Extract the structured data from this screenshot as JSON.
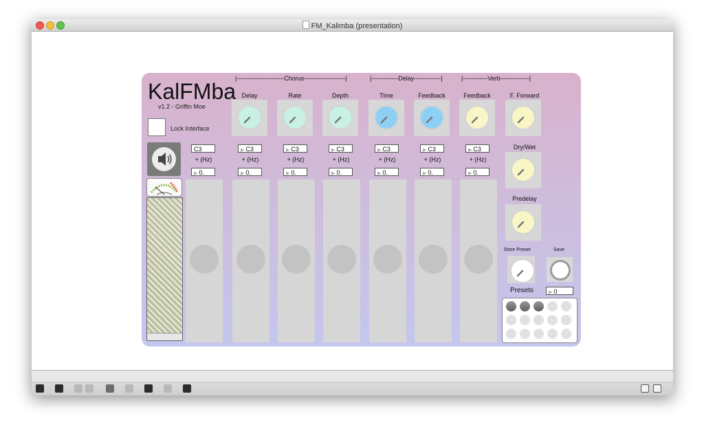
{
  "window": {
    "title": "FM_Kalimba (presentation)"
  },
  "panel": {
    "title": "KalFMba",
    "version": "v1.2 - Griffin Moe",
    "lock_label": "Lock Interface",
    "headers": {
      "chorus": "|-----------------------Chorus--------------------|",
      "delay": "|-------------Delay-------------|",
      "verb": "|------------Verb--------------|"
    },
    "columns": [
      {
        "label": "Delay",
        "note": "C3",
        "hz_label": "+ (Hz)",
        "hz": "0.",
        "dial_color": "#c8f1e4"
      },
      {
        "label": "Rate",
        "note": "C3",
        "hz_label": "+ (Hz)",
        "hz": "0.",
        "dial_color": "#c8f1e4"
      },
      {
        "label": "Depth",
        "note": "C3",
        "hz_label": "+ (Hz)",
        "hz": "0.",
        "dial_color": "#c8f1e4"
      },
      {
        "label": "Time",
        "note": "C3",
        "hz_label": "+ (Hz)",
        "hz": "0.",
        "dial_color": "#8ed0f3"
      },
      {
        "label": "Feedback",
        "note": "C3",
        "hz_label": "+ (Hz)",
        "hz": "0.",
        "dial_color": "#8ed0f3"
      },
      {
        "label": "Feedback",
        "note": "C3",
        "hz_label": "+ (Hz)",
        "hz": "0.",
        "dial_color": "#f8f5c6"
      }
    ],
    "slider_note": "C3",
    "slider_hz_label": "+ (Hz)",
    "slider_hz": "0.",
    "verb_right": {
      "forward_label": "F. Forward",
      "drywet_label": "Dry/Wet",
      "predelay_label": "Predelay",
      "dial_color": "#f8f5c6"
    },
    "presets": {
      "store_label": "Store Preset",
      "save_label": "Save",
      "presets_label": "Presets",
      "preset_value": "0"
    }
  },
  "toolbar": {
    "icons": [
      "lock-icon",
      "patch-icon",
      "pair-icon",
      "close-icon",
      "inspect-icon",
      "info-icon",
      "presentation-icon",
      "grid-icon",
      "debug-icon"
    ]
  }
}
